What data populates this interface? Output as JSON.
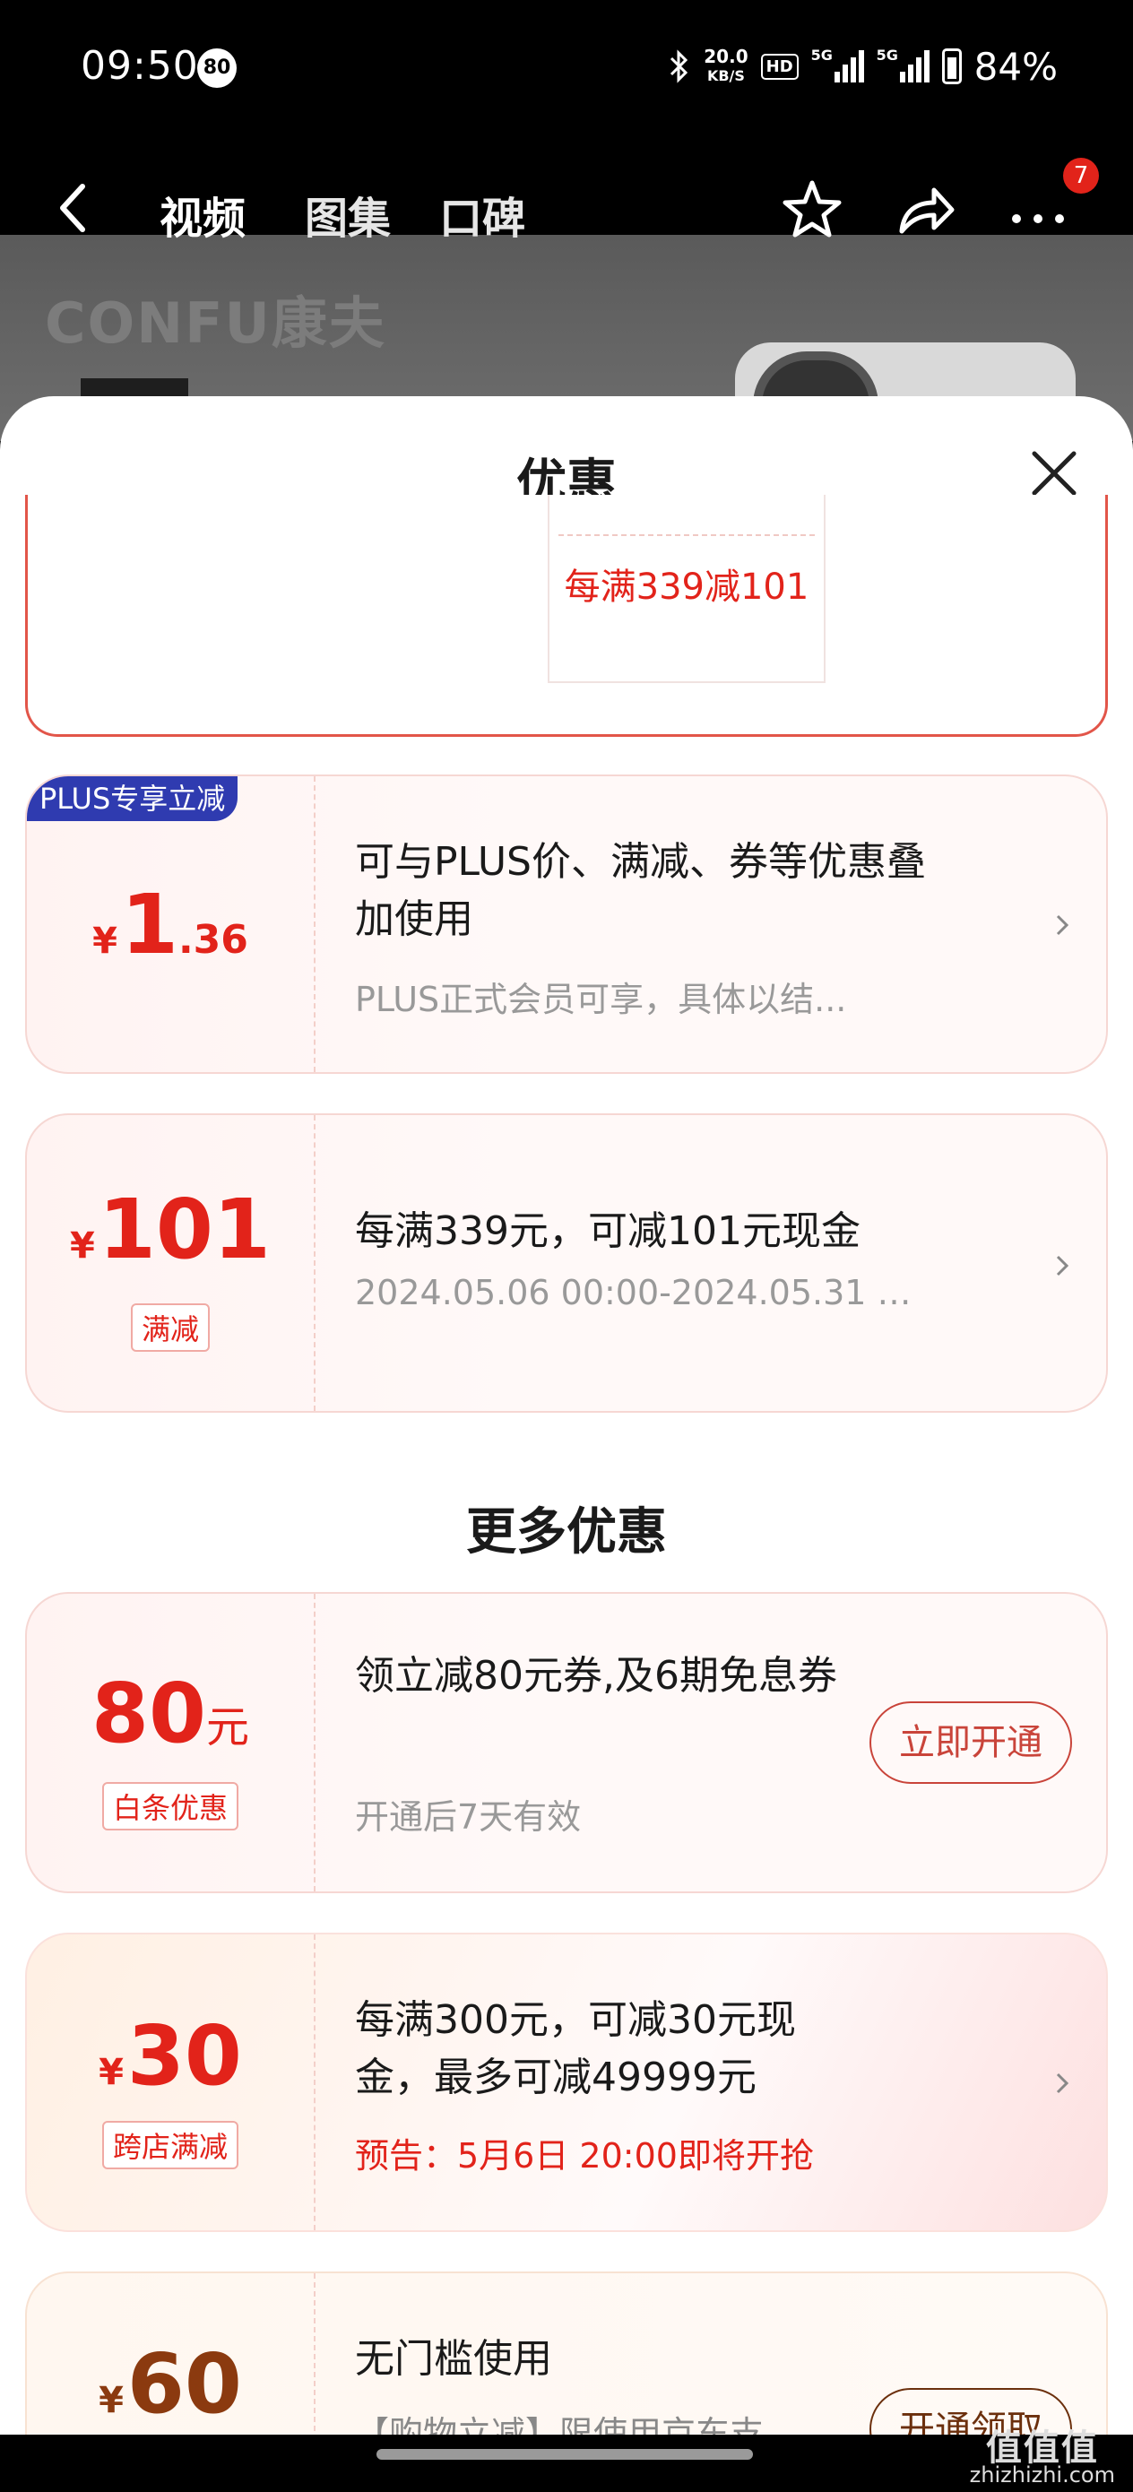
{
  "status_bar": {
    "time": "09:50",
    "notification_count": "80",
    "net_speed_value": "20.0",
    "net_speed_unit": "KB/S",
    "hd_label": "HD",
    "signal1_label": "5G",
    "signal2_label": "5G",
    "battery": "84%"
  },
  "nav": {
    "tabs": [
      "视频",
      "图集",
      "口碑"
    ],
    "cart_badge": "7"
  },
  "product": {
    "brand_text": "CONFU康夫"
  },
  "sheet": {
    "title": "优惠",
    "top_coupon_text": "每满339减101"
  },
  "offers": [
    {
      "corner_tag": "PLUS专享立减",
      "currency": "¥",
      "amount_int": "1",
      "amount_dec": ".36",
      "title": "可与PLUS价、满减、券等优惠叠加使用",
      "subtitle": "PLUS正式会员可享，具体以结..."
    },
    {
      "currency": "¥",
      "amount_int": "101",
      "tag": "满减",
      "title": "每满339元，可减101元现金",
      "subtitle": "2024.05.06 00:00-2024.05.31 2..."
    }
  ],
  "more_section_title": "更多优惠",
  "more_offers": [
    {
      "amount_int": "80",
      "unit": "元",
      "tag": "白条优惠",
      "title": "领立减80元券,及6期免息券",
      "subtitle": "开通后7天有效",
      "button": "立即开通"
    },
    {
      "currency": "¥",
      "amount_int": "30",
      "tag": "跨店满减",
      "title": "每满300元，可减30元现金，最多可减49999元",
      "subtitle": "预告：5月6日 20:00即将开抢"
    },
    {
      "currency": "¥",
      "amount_int": "60",
      "title": "无门槛使用",
      "subtitle": "【购物立减】限使用京东支...",
      "button": "开通领取"
    }
  ],
  "watermark": {
    "top": "值值值",
    "bottom": "zhizhizhi.com"
  },
  "colors": {
    "accent_red": "#e2231a",
    "plus_blue": "#2f3bb0",
    "brown": "#8b3a0f"
  }
}
